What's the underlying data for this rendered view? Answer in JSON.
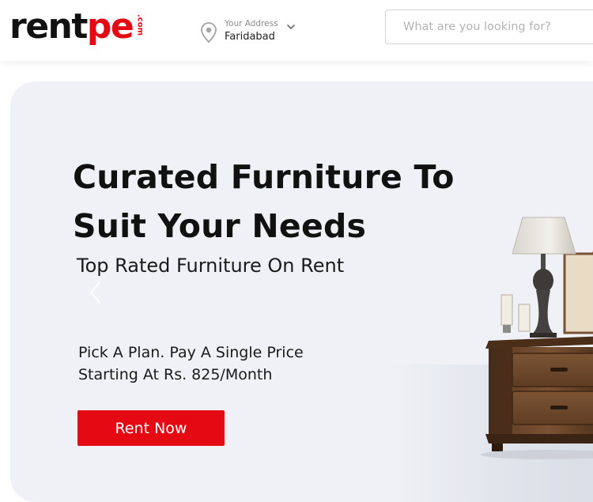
{
  "brand": {
    "logo_main": "rent",
    "logo_accent": "pe",
    "logo_suffix": ".com"
  },
  "header": {
    "address_label": "Your Address",
    "address_value": "Faridabad",
    "search_placeholder": "What are you looking for?"
  },
  "hero": {
    "title_line1": "Curated Furniture To",
    "title_line2": "Suit Your Needs",
    "subtitle": "Top Rated Furniture On Rent",
    "plan_line1": "Pick A Plan. Pay A Single Price",
    "plan_line2": "Starting At Rs. 825/Month",
    "cta_label": "Rent Now"
  },
  "colors": {
    "accent": "#e50914",
    "hero_background": "#eff1f6",
    "text_dark": "#111111"
  },
  "icons": {
    "location": "map-pin-icon",
    "address_dropdown": "chevron-down-icon",
    "carousel_prev": "chevron-left-icon"
  }
}
